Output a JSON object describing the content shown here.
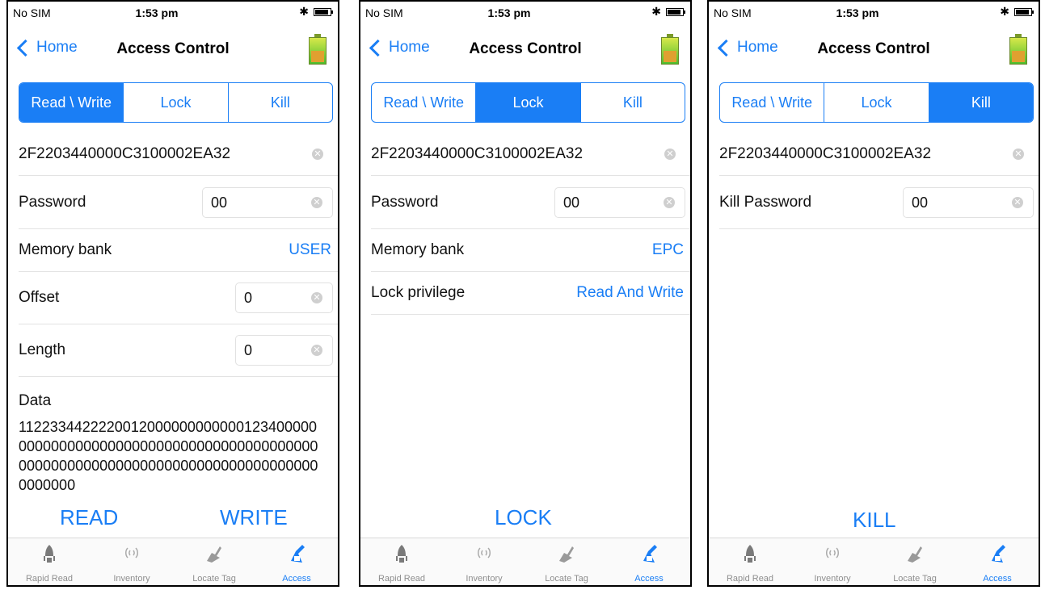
{
  "status": {
    "carrier": "No SIM",
    "time": "1:53 pm"
  },
  "nav": {
    "back": "Home",
    "title": "Access Control"
  },
  "segments": [
    "Read \\ Write",
    "Lock",
    "Kill"
  ],
  "tag_id": "2F2203440000C3100002EA32",
  "tabs": [
    "Rapid Read",
    "Inventory",
    "Locate Tag",
    "Access"
  ],
  "colors": {
    "accent": "#1a7ef5"
  },
  "screen_rw": {
    "password_label": "Password",
    "password_value": "00",
    "bank_label": "Memory bank",
    "bank_value": "USER",
    "offset_label": "Offset",
    "offset_value": "0",
    "length_label": "Length",
    "length_value": "0",
    "data_label": "Data",
    "data_value": "1122334422220012000000000000123400000000000000000000000000000000000000000000000000000000000000000000000000000000000000",
    "read": "READ",
    "write": "WRITE"
  },
  "screen_lock": {
    "password_label": "Password",
    "password_value": "00",
    "bank_label": "Memory bank",
    "bank_value": "EPC",
    "priv_label": "Lock privilege",
    "priv_value": "Read And Write",
    "lock": "LOCK"
  },
  "screen_kill": {
    "kill_pw_label": "Kill Password",
    "kill_pw_value": "00",
    "kill": "KILL"
  }
}
